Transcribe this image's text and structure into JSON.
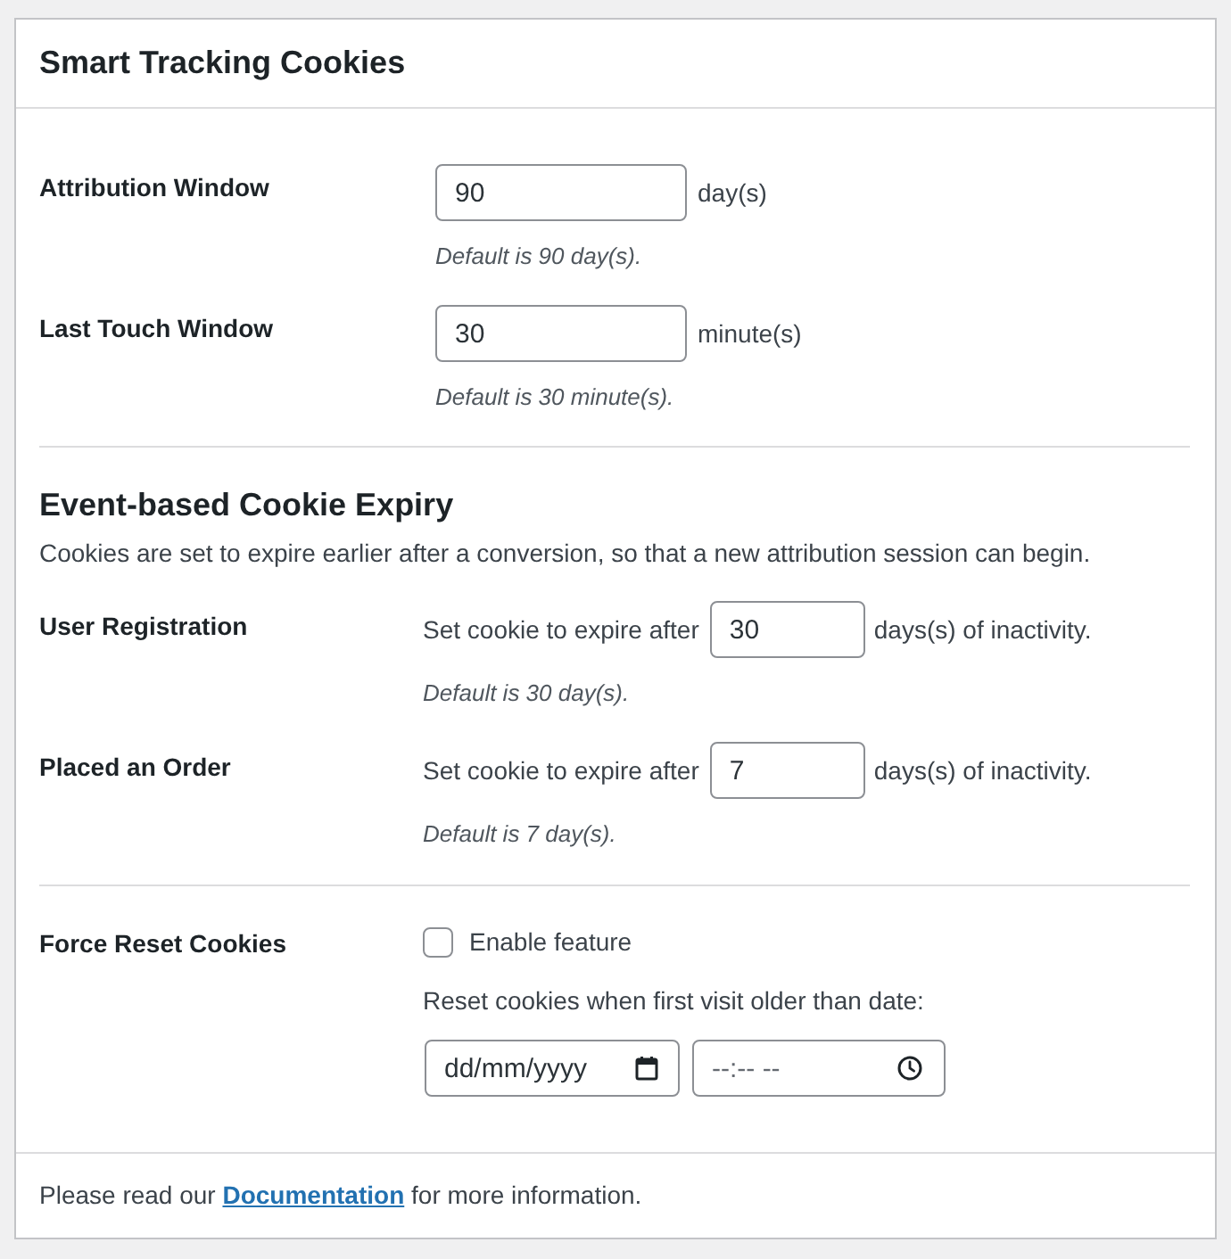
{
  "panel": {
    "title": "Smart Tracking Cookies"
  },
  "windows": [
    {
      "label": "Attribution Window",
      "value": "90",
      "unit": "day(s)",
      "hint": "Default is 90 day(s)."
    },
    {
      "label": "Last Touch Window",
      "value": "30",
      "unit": "minute(s)",
      "hint": "Default is 30 minute(s)."
    }
  ],
  "event_expiry": {
    "heading": "Event-based Cookie Expiry",
    "description": "Cookies are set to expire earlier after a conversion, so that a new attribution session can begin.",
    "rows": [
      {
        "label": "User Registration",
        "prefix": "Set cookie to expire after",
        "value": "30",
        "suffix": "days(s) of inactivity.",
        "hint": "Default is 30 day(s)."
      },
      {
        "label": "Placed an Order",
        "prefix": "Set cookie to expire after",
        "value": "7",
        "suffix": "days(s) of inactivity.",
        "hint": "Default is 7 day(s)."
      }
    ]
  },
  "force_reset": {
    "label": "Force Reset Cookies",
    "checkbox": {
      "label": "Enable feature",
      "checked": false
    },
    "prompt": "Reset cookies when first visit older than date:",
    "date_field": {
      "placeholder": "dd/mm/yyyy"
    },
    "time_field": {
      "placeholder": "--:-- --"
    }
  },
  "footer": {
    "text_before": "Please read our",
    "link": "Documentation",
    "text_after": "for more information."
  }
}
